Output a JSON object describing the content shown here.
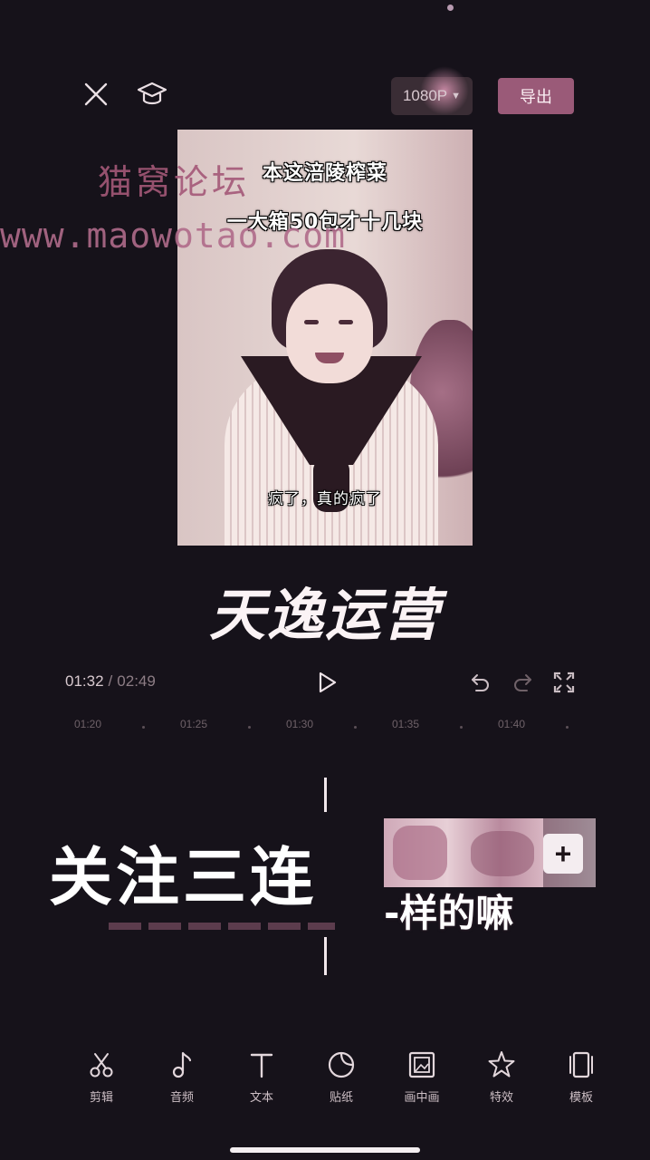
{
  "header": {
    "resolution": "1080P",
    "export_label": "导出"
  },
  "video": {
    "caption_top1": "本这涪陵榨菜",
    "caption_top2": "一大箱50包才十几块",
    "caption_bottom": "疯了，真的疯了"
  },
  "watermark": {
    "line1": "猫窝论坛",
    "line2": "www.maowotao.com"
  },
  "overlay_brand": "天逸运营",
  "playback": {
    "current": "01:32",
    "separator": "/",
    "total": "02:49"
  },
  "ruler": [
    "01:20",
    "01:25",
    "01:30",
    "01:35",
    "01:40"
  ],
  "timeline": {
    "overlay_text": "关注三连",
    "clip_caption": "-样的嘛",
    "add_symbol": "+"
  },
  "toolbar": [
    {
      "label": "剪辑",
      "icon": "scissors-icon"
    },
    {
      "label": "音频",
      "icon": "music-note-icon"
    },
    {
      "label": "文本",
      "icon": "text-icon"
    },
    {
      "label": "贴纸",
      "icon": "sticker-icon"
    },
    {
      "label": "画中画",
      "icon": "picture-in-picture-icon"
    },
    {
      "label": "特效",
      "icon": "effects-star-icon"
    },
    {
      "label": "模板",
      "icon": "template-icon"
    }
  ],
  "colors": {
    "background": "#16121a",
    "accent": "#9a5a78",
    "watermark": "#a45878"
  }
}
